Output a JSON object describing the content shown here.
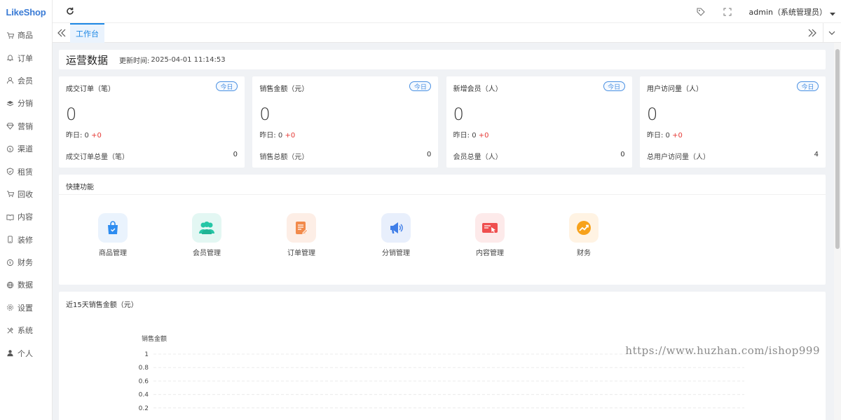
{
  "app": {
    "logo": "LikeShop"
  },
  "sidebar": {
    "items": [
      {
        "label": "商品",
        "icon": "cart-icon"
      },
      {
        "label": "订单",
        "icon": "bell-icon"
      },
      {
        "label": "会员",
        "icon": "user-icon"
      },
      {
        "label": "分销",
        "icon": "layers-icon"
      },
      {
        "label": "营销",
        "icon": "diamond-icon"
      },
      {
        "label": "渠道",
        "icon": "coin-icon"
      },
      {
        "label": "租赁",
        "icon": "shield-check-icon"
      },
      {
        "label": "回收",
        "icon": "cart-icon"
      },
      {
        "label": "内容",
        "icon": "book-icon"
      },
      {
        "label": "装修",
        "icon": "mobile-icon"
      },
      {
        "label": "财务",
        "icon": "yen-icon"
      },
      {
        "label": "数据",
        "icon": "globe-icon"
      },
      {
        "label": "设置",
        "icon": "gear-icon"
      },
      {
        "label": "系统",
        "icon": "tools-icon"
      },
      {
        "label": "个人",
        "icon": "person-icon"
      }
    ]
  },
  "topbar": {
    "user": "admin（系统管理员）"
  },
  "tabs": {
    "active": "工作台"
  },
  "header": {
    "title": "运营数据",
    "update_label": "更新时间:",
    "update_time": "2025-04-01 11:14:53"
  },
  "stats": [
    {
      "title": "成交订单（笔）",
      "tag": "今日",
      "value": "0",
      "yesterday_label": "昨日: 0",
      "delta": "+0",
      "total_label": "成交订单总量（笔）",
      "total": "0"
    },
    {
      "title": "销售金额（元）",
      "tag": "今日",
      "value": "0",
      "yesterday_label": "昨日: 0",
      "delta": "+0",
      "total_label": "销售总额（元）",
      "total": "0"
    },
    {
      "title": "新增会员（人）",
      "tag": "今日",
      "value": "0",
      "yesterday_label": "昨日: 0",
      "delta": "+0",
      "total_label": "会员总量（人）",
      "total": "0"
    },
    {
      "title": "用户访问量（人）",
      "tag": "今日",
      "value": "0",
      "yesterday_label": "昨日: 0",
      "delta": "+0",
      "total_label": "总用户访问量（人）",
      "total": "4"
    }
  ],
  "quick": {
    "title": "快捷功能",
    "items": [
      {
        "label": "商品管理",
        "icon": "shopping-bag-icon",
        "bg": "#eaf3fd",
        "fg": "#2d8cf0"
      },
      {
        "label": "会员管理",
        "icon": "users-icon",
        "bg": "#e3f7f3",
        "fg": "#26c6a6"
      },
      {
        "label": "订单管理",
        "icon": "order-edit-icon",
        "bg": "#fdeee6",
        "fg": "#f28a4b"
      },
      {
        "label": "分销管理",
        "icon": "megaphone-icon",
        "bg": "#e8effc",
        "fg": "#3f7ee8"
      },
      {
        "label": "内容管理",
        "icon": "content-icon",
        "bg": "#fdeaea",
        "fg": "#ef4f4f"
      },
      {
        "label": "财务",
        "icon": "trend-icon",
        "bg": "#fff3e3",
        "fg": "#f7a21b"
      }
    ]
  },
  "chart": {
    "title": "近15天销售金额（元）"
  },
  "chart_data": {
    "type": "line",
    "title": "近15天销售金额（元）",
    "series": [
      {
        "name": "销售金额",
        "values": []
      }
    ],
    "ylabel": "",
    "ylim": [
      0,
      1
    ],
    "y_ticks": [
      "1",
      "0.8",
      "0.6",
      "0.4",
      "0.2"
    ],
    "grid": true
  },
  "watermark": "https://www.huzhan.com/ishop999",
  "colors": {
    "primary": "#1e88e5",
    "red": "#e53935",
    "bg": "#f0f2f5"
  }
}
